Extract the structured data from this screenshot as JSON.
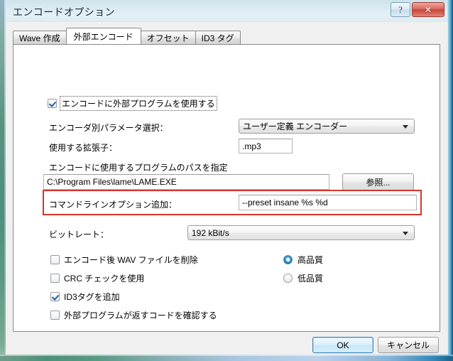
{
  "window": {
    "title": "エンコードオプション",
    "help_button": "?",
    "close_button": "✕"
  },
  "tabs": [
    {
      "label": "Wave 作成",
      "active": false
    },
    {
      "label": "外部エンコード",
      "active": true
    },
    {
      "label": "オフセット",
      "active": false
    },
    {
      "label": "ID3 タグ",
      "active": false
    }
  ],
  "form": {
    "use_external_program": {
      "label": "エンコードに外部プログラムを使用する",
      "checked": true,
      "focused": true
    },
    "encoder_param_label": "エンコーダ別パラメータ選択：",
    "encoder_param_value": "ユーザー定義 エンコーダー",
    "extension_label": "使用する拡張子：",
    "extension_value": ".mp3",
    "program_path_label": "エンコードに使用するプログラムのパスを指定",
    "program_path_value": "C:\\Program Files\\lame\\LAME.EXE",
    "browse_button": "参照...",
    "command_line_label": "コマンドラインオプション追加：",
    "command_line_value": "--preset insane %s %d",
    "bitrate_label": "ビットレート：",
    "bitrate_value": "192 kBit/s",
    "checkboxes": [
      {
        "label": "エンコード後 WAV ファイルを削除",
        "checked": false
      },
      {
        "label": "CRC チェックを使用",
        "checked": false
      },
      {
        "label": "ID3タグを追加",
        "checked": true
      },
      {
        "label": "外部プログラムが返すコードを確認する",
        "checked": false
      }
    ],
    "quality_radios": [
      {
        "label": "高品質",
        "selected": true
      },
      {
        "label": "低品質",
        "selected": false
      }
    ]
  },
  "footer": {
    "ok_button": "OK",
    "cancel_button": "キャンセル"
  },
  "colors": {
    "highlight_box": "#d3362c",
    "title_text": "#1b2b33",
    "close_button": "#c9453a",
    "default_button_border": "#3c7fb1",
    "radio_selected": "#1f7fc0"
  }
}
